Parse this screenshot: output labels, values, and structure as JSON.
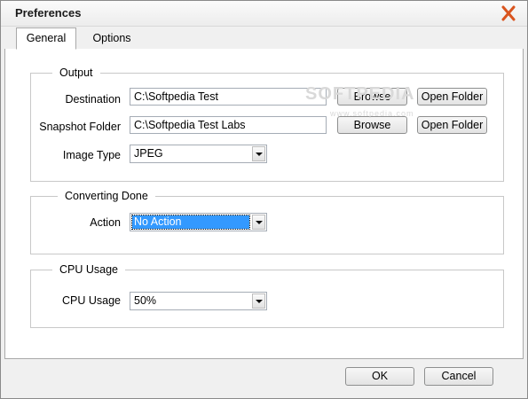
{
  "window": {
    "title": "Preferences"
  },
  "tabs": [
    {
      "label": "General",
      "active": true
    },
    {
      "label": "Options",
      "active": false
    }
  ],
  "output": {
    "legend": "Output",
    "destination": {
      "label": "Destination",
      "value": "C:\\Softpedia Test"
    },
    "snapshot": {
      "label": "Snapshot Folder",
      "value": "C:\\Softpedia Test Labs"
    },
    "image_type": {
      "label": "Image Type",
      "value": "JPEG"
    },
    "browse_label": "Browse",
    "open_folder_label": "Open Folder"
  },
  "converting": {
    "legend": "Converting Done",
    "action": {
      "label": "Action",
      "value": "No Action"
    }
  },
  "cpu": {
    "legend": "CPU Usage",
    "usage": {
      "label": "CPU Usage",
      "value": "50%"
    }
  },
  "footer": {
    "ok_label": "OK",
    "cancel_label": "Cancel"
  },
  "watermark": {
    "brand": "SOFTPEDIA",
    "url": "www.softpedia.com"
  },
  "colors": {
    "selection": "#3399ff",
    "close_icon": "#d9541e"
  },
  "icons": {
    "close": "close-x-icon",
    "dropdown": "chevron-down-icon"
  }
}
